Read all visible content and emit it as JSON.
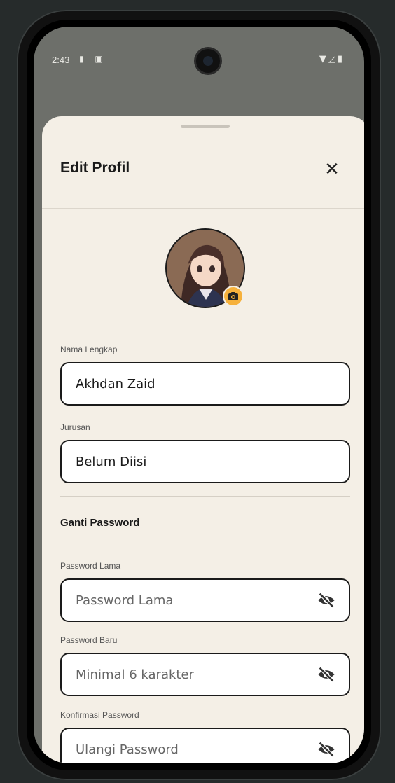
{
  "status_bar": {
    "time": "2:43"
  },
  "sheet": {
    "title": "Edit Profil",
    "close_label": "✕"
  },
  "profile": {
    "name_label": "Nama Lengkap",
    "name_value": "Akhdan Zaid",
    "major_label": "Jurusan",
    "major_value": "Belum Diisi"
  },
  "password": {
    "section_title": "Ganti Password",
    "old_label": "Password Lama",
    "old_placeholder": "Password Lama",
    "new_label": "Password Baru",
    "new_placeholder": "Minimal 6 karakter",
    "confirm_label": "Konfirmasi Password",
    "confirm_placeholder": "Ulangi Password"
  },
  "colors": {
    "accent": "#f6b13c",
    "sheet_bg": "#f4efe6"
  },
  "icons": [
    "close-icon",
    "camera-icon",
    "eye-off-icon"
  ]
}
